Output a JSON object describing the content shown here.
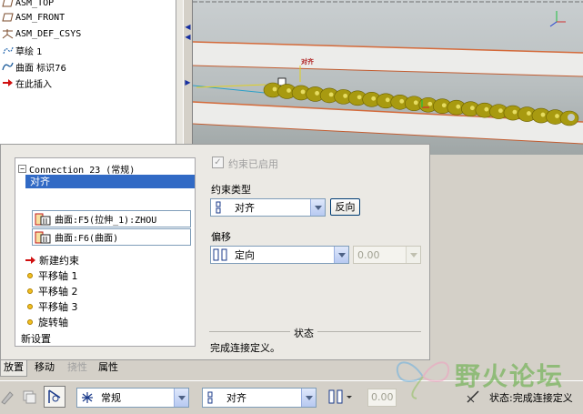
{
  "model_tree": {
    "items": [
      {
        "label": "ASM_TOP",
        "icon": "datum-plane-icon"
      },
      {
        "label": "ASM_FRONT",
        "icon": "datum-plane-icon"
      },
      {
        "label": "ASM_DEF_CSYS",
        "icon": "csys-icon"
      },
      {
        "label": "草绘 1",
        "icon": "sketch-icon"
      },
      {
        "label": "曲面 标识76",
        "icon": "surface-icon"
      },
      {
        "label": "在此插入",
        "icon": "insert-here-arrow-icon"
      }
    ]
  },
  "viewport": {
    "annotation_label": "对齐",
    "colors": {
      "chain": "#a89a10",
      "guide_rail": "#e8e8e8",
      "guide_edge": "#d46a3a"
    }
  },
  "connection_panel": {
    "connection_title": "Connection_23 (常规)",
    "selected_constraint": "对齐",
    "references": [
      "曲面:F5(拉伸_1):ZHOU",
      "曲面:F6(曲面)"
    ],
    "new_constraint": "新建约束",
    "axes": [
      "平移轴 1",
      "平移轴 2",
      "平移轴 3",
      "旋转轴"
    ],
    "new_set": "新设置",
    "constraint_enabled_label": "约束已启用",
    "constraint_type_label": "约束类型",
    "constraint_type_value": "对齐",
    "flip_button": "反向",
    "offset_label": "偏移",
    "offset_mode": "定向",
    "offset_value": "0.00",
    "status_title": "状态",
    "status_text": "完成连接定义。"
  },
  "tabs": [
    {
      "label": "放置",
      "state": "active"
    },
    {
      "label": "移动",
      "state": "normal"
    },
    {
      "label": "挠性",
      "state": "disabled"
    },
    {
      "label": "属性",
      "state": "normal"
    }
  ],
  "toolbar": {
    "connection_type": "常规",
    "constraint_type": "对齐",
    "offset_value": "0.00",
    "status": "状态:完成连接定义"
  },
  "watermark": {
    "text": "野火论坛"
  }
}
